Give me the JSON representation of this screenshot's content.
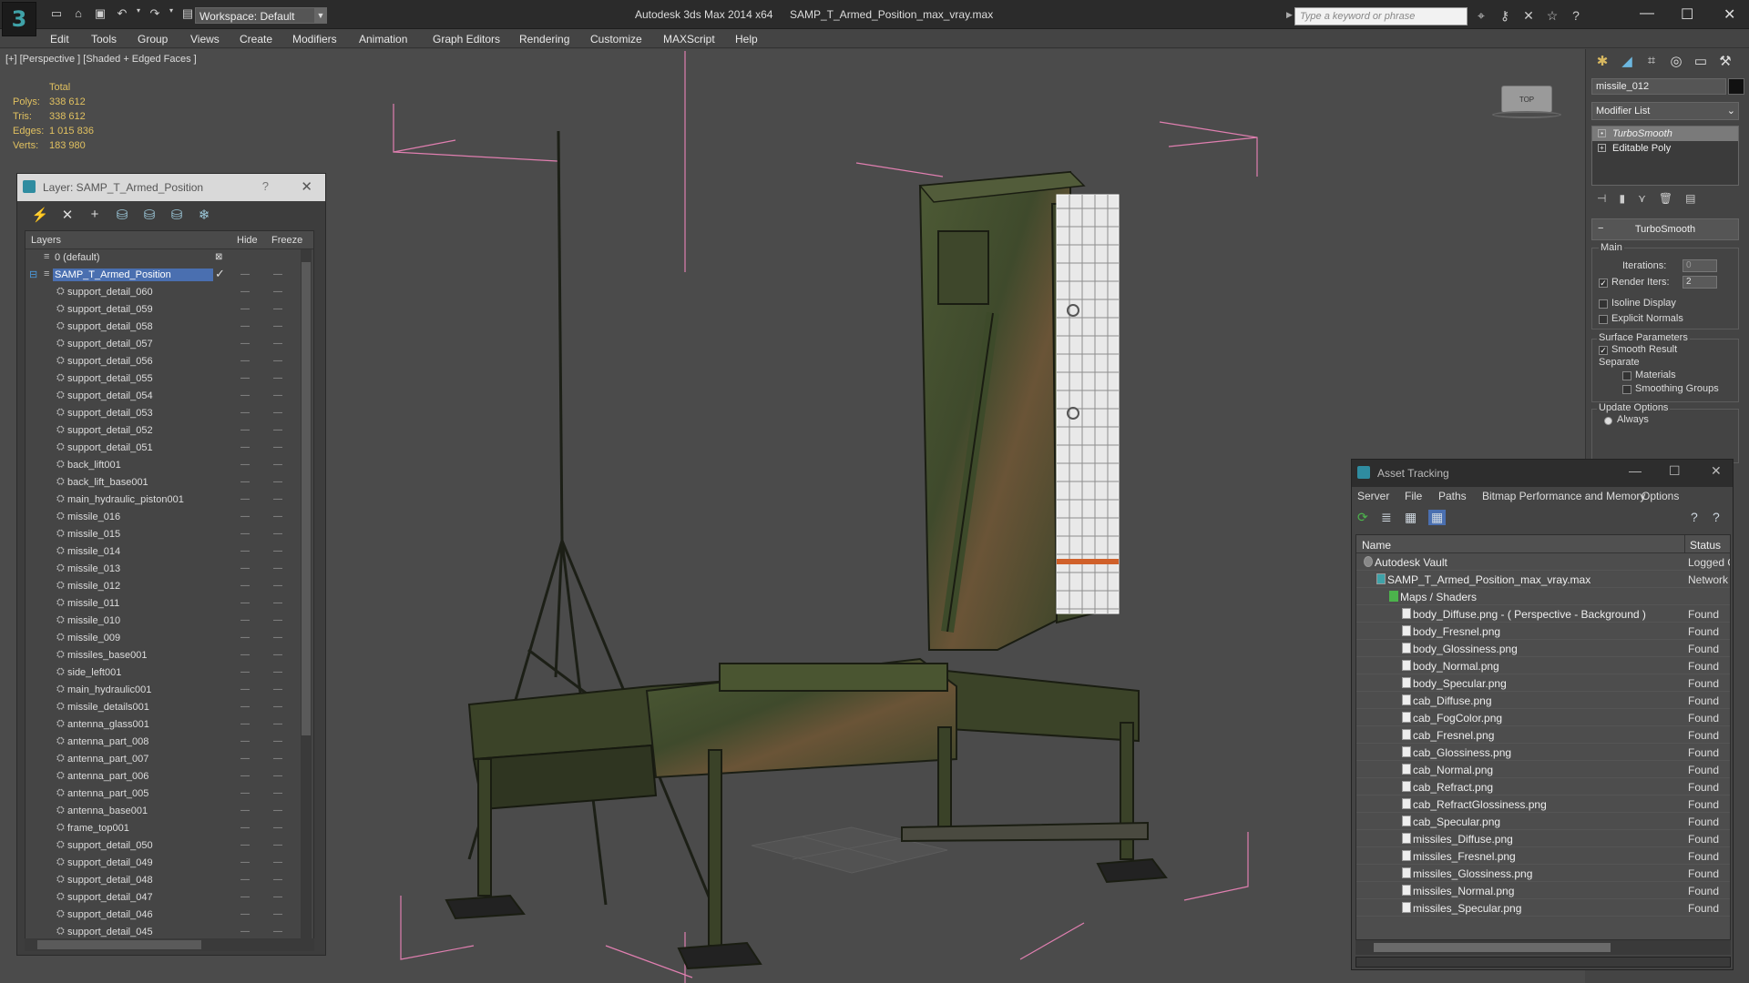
{
  "titlebar": {
    "app": "Autodesk 3ds Max  2014 x64",
    "document": "SAMP_T_Armed_Position_max_vray.max",
    "workspace": "Workspace: Default",
    "search_placeholder": "Type a keyword or phrase"
  },
  "menu": [
    "Edit",
    "Tools",
    "Group",
    "Views",
    "Create",
    "Modifiers",
    "Animation",
    "Graph Editors",
    "Rendering",
    "Customize",
    "MAXScript",
    "Help"
  ],
  "viewport": {
    "label": "[+] [Perspective ] [Shaded + Edged Faces ]",
    "stats": {
      "total_label": "Total",
      "polys_label": "Polys:",
      "polys": "338 612",
      "tris_label": "Tris:",
      "tris": "338 612",
      "edges_label": "Edges:",
      "edges": "1 015 836",
      "verts_label": "Verts:",
      "verts": "183 980"
    },
    "bg_color": "#4b4b4b"
  },
  "layer_window": {
    "title": "Layer: SAMP_T_Armed_Position",
    "help": "?",
    "col_layers": "Layers",
    "col_hide": "Hide",
    "col_freeze": "Freeze",
    "default_layer": "0 (default)",
    "active_layer": "SAMP_T_Armed_Position",
    "items": [
      "support_detail_060",
      "support_detail_059",
      "support_detail_058",
      "support_detail_057",
      "support_detail_056",
      "support_detail_055",
      "support_detail_054",
      "support_detail_053",
      "support_detail_052",
      "support_detail_051",
      "back_lift001",
      "back_lift_base001",
      "main_hydraulic_piston001",
      "missile_016",
      "missile_015",
      "missile_014",
      "missile_013",
      "missile_012",
      "missile_011",
      "missile_010",
      "missile_009",
      "missiles_base001",
      "side_left001",
      "main_hydraulic001",
      "missile_details001",
      "antenna_glass001",
      "antenna_part_008",
      "antenna_part_007",
      "antenna_part_006",
      "antenna_part_005",
      "antenna_base001",
      "frame_top001",
      "support_detail_050",
      "support_detail_049",
      "support_detail_048",
      "support_detail_047",
      "support_detail_046",
      "support_detail_045"
    ]
  },
  "command_panel": {
    "object_name": "missile_012",
    "modifier_list": "Modifier List",
    "stack": [
      "TurboSmooth",
      "Editable Poly"
    ],
    "rollout": "TurboSmooth",
    "main_label": "Main",
    "iterations_label": "Iterations:",
    "iterations": "0",
    "render_iters_label": "Render Iters:",
    "render_iters": "2",
    "isoline": "Isoline Display",
    "explicit": "Explicit Normals",
    "surface_params": "Surface Parameters",
    "smooth_result": "Smooth Result",
    "separate": "Separate",
    "materials": "Materials",
    "smoothing_groups": "Smoothing Groups",
    "update_options": "Update Options",
    "always": "Always"
  },
  "asset_tracking": {
    "title": "Asset Tracking",
    "menu": [
      "Server",
      "File",
      "Paths",
      "Bitmap Performance and Memory",
      "Options"
    ],
    "col_name": "Name",
    "col_status": "Status",
    "rows": [
      {
        "name": "Autodesk Vault",
        "status": "Logged Ou",
        "indent": 0
      },
      {
        "name": "SAMP_T_Armed_Position_max_vray.max",
        "status": "Network P",
        "indent": 1
      },
      {
        "name": "Maps / Shaders",
        "status": "",
        "indent": 2
      },
      {
        "name": "body_Diffuse.png -  ( Perspective - Background )",
        "status": "Found",
        "indent": 3
      },
      {
        "name": "body_Fresnel.png",
        "status": "Found",
        "indent": 3
      },
      {
        "name": "body_Glossiness.png",
        "status": "Found",
        "indent": 3
      },
      {
        "name": "body_Normal.png",
        "status": "Found",
        "indent": 3
      },
      {
        "name": "body_Specular.png",
        "status": "Found",
        "indent": 3
      },
      {
        "name": "cab_Diffuse.png",
        "status": "Found",
        "indent": 3
      },
      {
        "name": "cab_FogColor.png",
        "status": "Found",
        "indent": 3
      },
      {
        "name": "cab_Fresnel.png",
        "status": "Found",
        "indent": 3
      },
      {
        "name": "cab_Glossiness.png",
        "status": "Found",
        "indent": 3
      },
      {
        "name": "cab_Normal.png",
        "status": "Found",
        "indent": 3
      },
      {
        "name": "cab_Refract.png",
        "status": "Found",
        "indent": 3
      },
      {
        "name": "cab_RefractGlossiness.png",
        "status": "Found",
        "indent": 3
      },
      {
        "name": "cab_Specular.png",
        "status": "Found",
        "indent": 3
      },
      {
        "name": "missiles_Diffuse.png",
        "status": "Found",
        "indent": 3
      },
      {
        "name": "missiles_Fresnel.png",
        "status": "Found",
        "indent": 3
      },
      {
        "name": "missiles_Glossiness.png",
        "status": "Found",
        "indent": 3
      },
      {
        "name": "missiles_Normal.png",
        "status": "Found",
        "indent": 3
      },
      {
        "name": "missiles_Specular.png",
        "status": "Found",
        "indent": 3
      }
    ]
  }
}
